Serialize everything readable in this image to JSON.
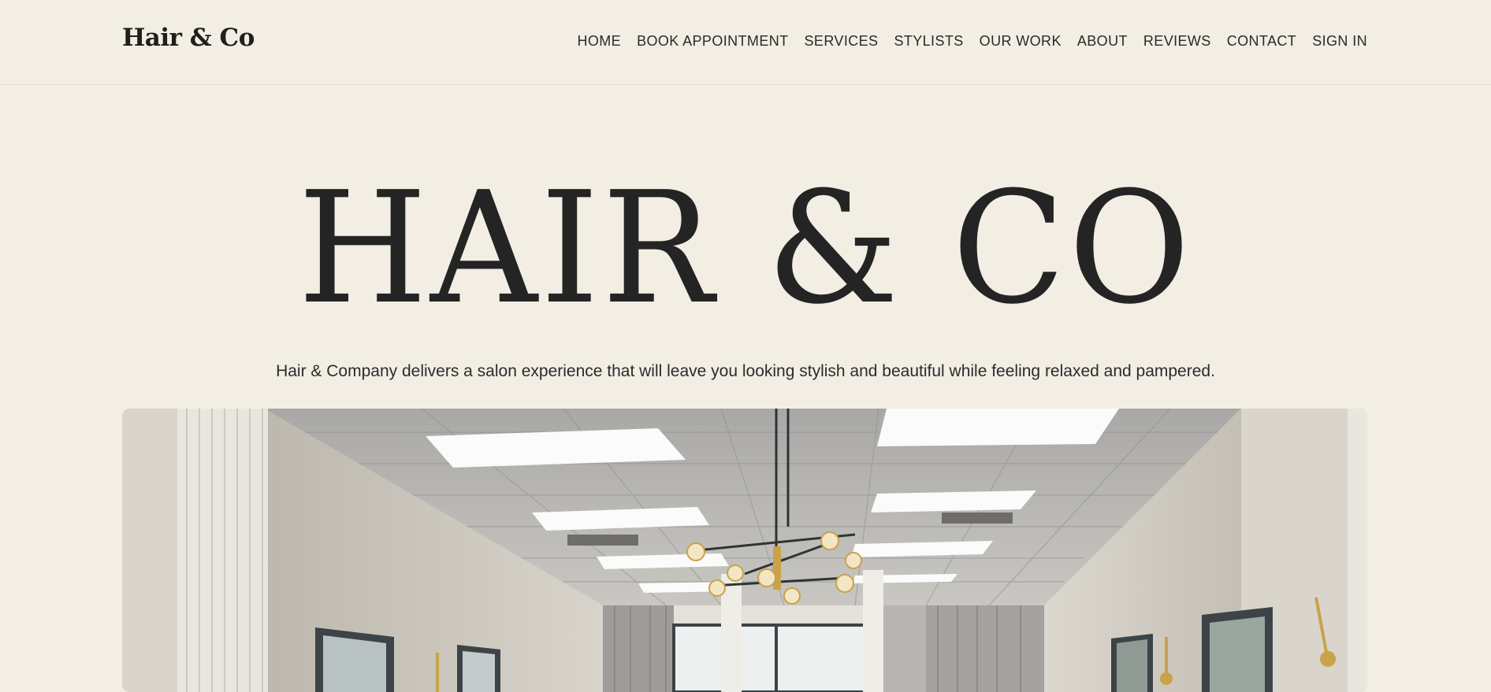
{
  "header": {
    "brand": "Hair & Co",
    "nav": [
      {
        "label": "HOME"
      },
      {
        "label": "BOOK APPOINTMENT"
      },
      {
        "label": "SERVICES"
      },
      {
        "label": "STYLISTS"
      },
      {
        "label": "OUR WORK"
      },
      {
        "label": "ABOUT"
      },
      {
        "label": "REVIEWS"
      },
      {
        "label": "CONTACT"
      },
      {
        "label": "SIGN IN"
      }
    ]
  },
  "hero": {
    "title": "HAIR & CO",
    "tagline": "Hair & Company delivers a salon experience that will leave you looking stylish and beautiful while feeling relaxed and pampered.",
    "image_icon": "salon-interior-photo"
  },
  "colors": {
    "background": "#f2eee4",
    "text": "#222222",
    "divider": "#e6e1d5"
  }
}
